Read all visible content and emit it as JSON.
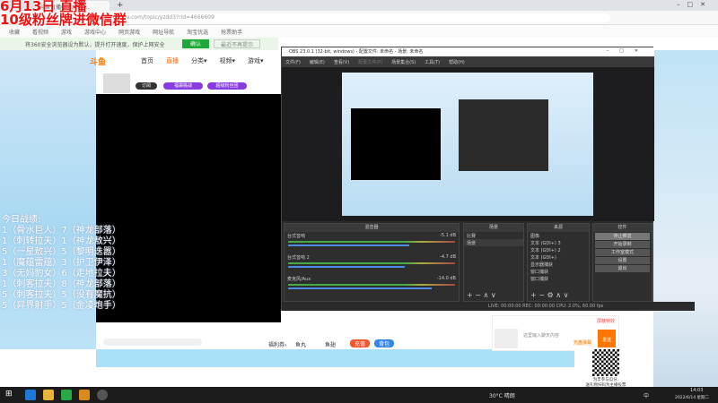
{
  "browser": {
    "tab_title": "斗鱼直播间 - 虎牙 ...",
    "url": "https://www.douyu.com/topic/yzdd3?rid=4666609",
    "bookmarks": [
      "收藏",
      "看视频",
      "游戏",
      "游戏中心",
      "网页游戏",
      "网址导航",
      "淘宝优选",
      "抢票助手"
    ],
    "notice": "将360安全浏览器设为默认，提升打开速度，保护上网安全",
    "notice_ok": "确认",
    "notice_no": "最近不再提示"
  },
  "overlay": {
    "line1": "6月13日 直播",
    "line2": "10级粉丝牌进微信群"
  },
  "ranking": {
    "title": "今日战绩:",
    "rows": [
      "1（骨水巨人）7（神龙部落）",
      "1（刺转拉夫）1（神龙敖兴）",
      "5（一星敖兴）5（黎明迭嚣）",
      "1（魔蕴雷蕴）3（护卫伊泽）",
      "3（无妈豹女）6（走地拉夫）",
      "1（刺客拉夫）8（神龙部落）",
      "5（刺客拉夫）5（没有魔抗）",
      "5（异界射手）5（金凌炮手）"
    ]
  },
  "site": {
    "logo": "斗鱼",
    "nav": [
      "首页",
      "直播",
      "分类▾",
      "视频▾",
      "游戏▾"
    ],
    "anchor_btns": [
      "订阅",
      "福袋挑战",
      "超级粉丝团"
    ]
  },
  "chatbar": {
    "items": [
      "福利券›",
      "鱼丸",
      "鱼翅"
    ],
    "btn1": "充值",
    "btn2": "背包"
  },
  "obs": {
    "title": "OBS 23.0.1 (32-bit, windows) - 配置文件: 未命名 - 场景: 未命名",
    "menu": [
      "文件(F)",
      "编辑(E)",
      "查看(V)",
      "配置文件(P)",
      "场景集合(S)",
      "工具(T)",
      "帮助(H)"
    ],
    "mixer": {
      "title": "混音器",
      "channels": [
        {
          "name": "台式音响",
          "db": "-5.1 dB"
        },
        {
          "name": "台式音响 2",
          "db": "-4.7 dB"
        },
        {
          "name": "麦克风/Aux",
          "db": "-14.0 dB"
        }
      ]
    },
    "scenes": {
      "title": "场景",
      "items": [
        "比赛",
        "场景"
      ]
    },
    "sources": {
      "title": "来源",
      "items": [
        "图像",
        "文本 (GDI+) 3",
        "文本 (GDI+) 2",
        "文本 (GDI+)",
        "显示器捕获",
        "窗口捕获",
        "窗口捕获"
      ]
    },
    "controls": {
      "title": "控件",
      "items": [
        "停止推流",
        "开始录制",
        "工作室模式",
        "设置",
        "退出"
      ]
    },
    "status": "LIVE: 00:00:00   REC: 00:00:00   CPU: 2.0%, 60.00 fps"
  },
  "chat": {
    "placeholder": "这里输入聊天内容",
    "send": "发送",
    "toggle": "屏蔽特效",
    "hint": "光盘弹幕"
  },
  "qr": {
    "line1": "为丰参与瓜分,",
    "line2": "送礼物扫码为主播投票"
  },
  "taskbar": {
    "weather": "30°C 晴朗",
    "ime": "中",
    "time": "14:03",
    "date": "2022/6/14 星期二"
  }
}
